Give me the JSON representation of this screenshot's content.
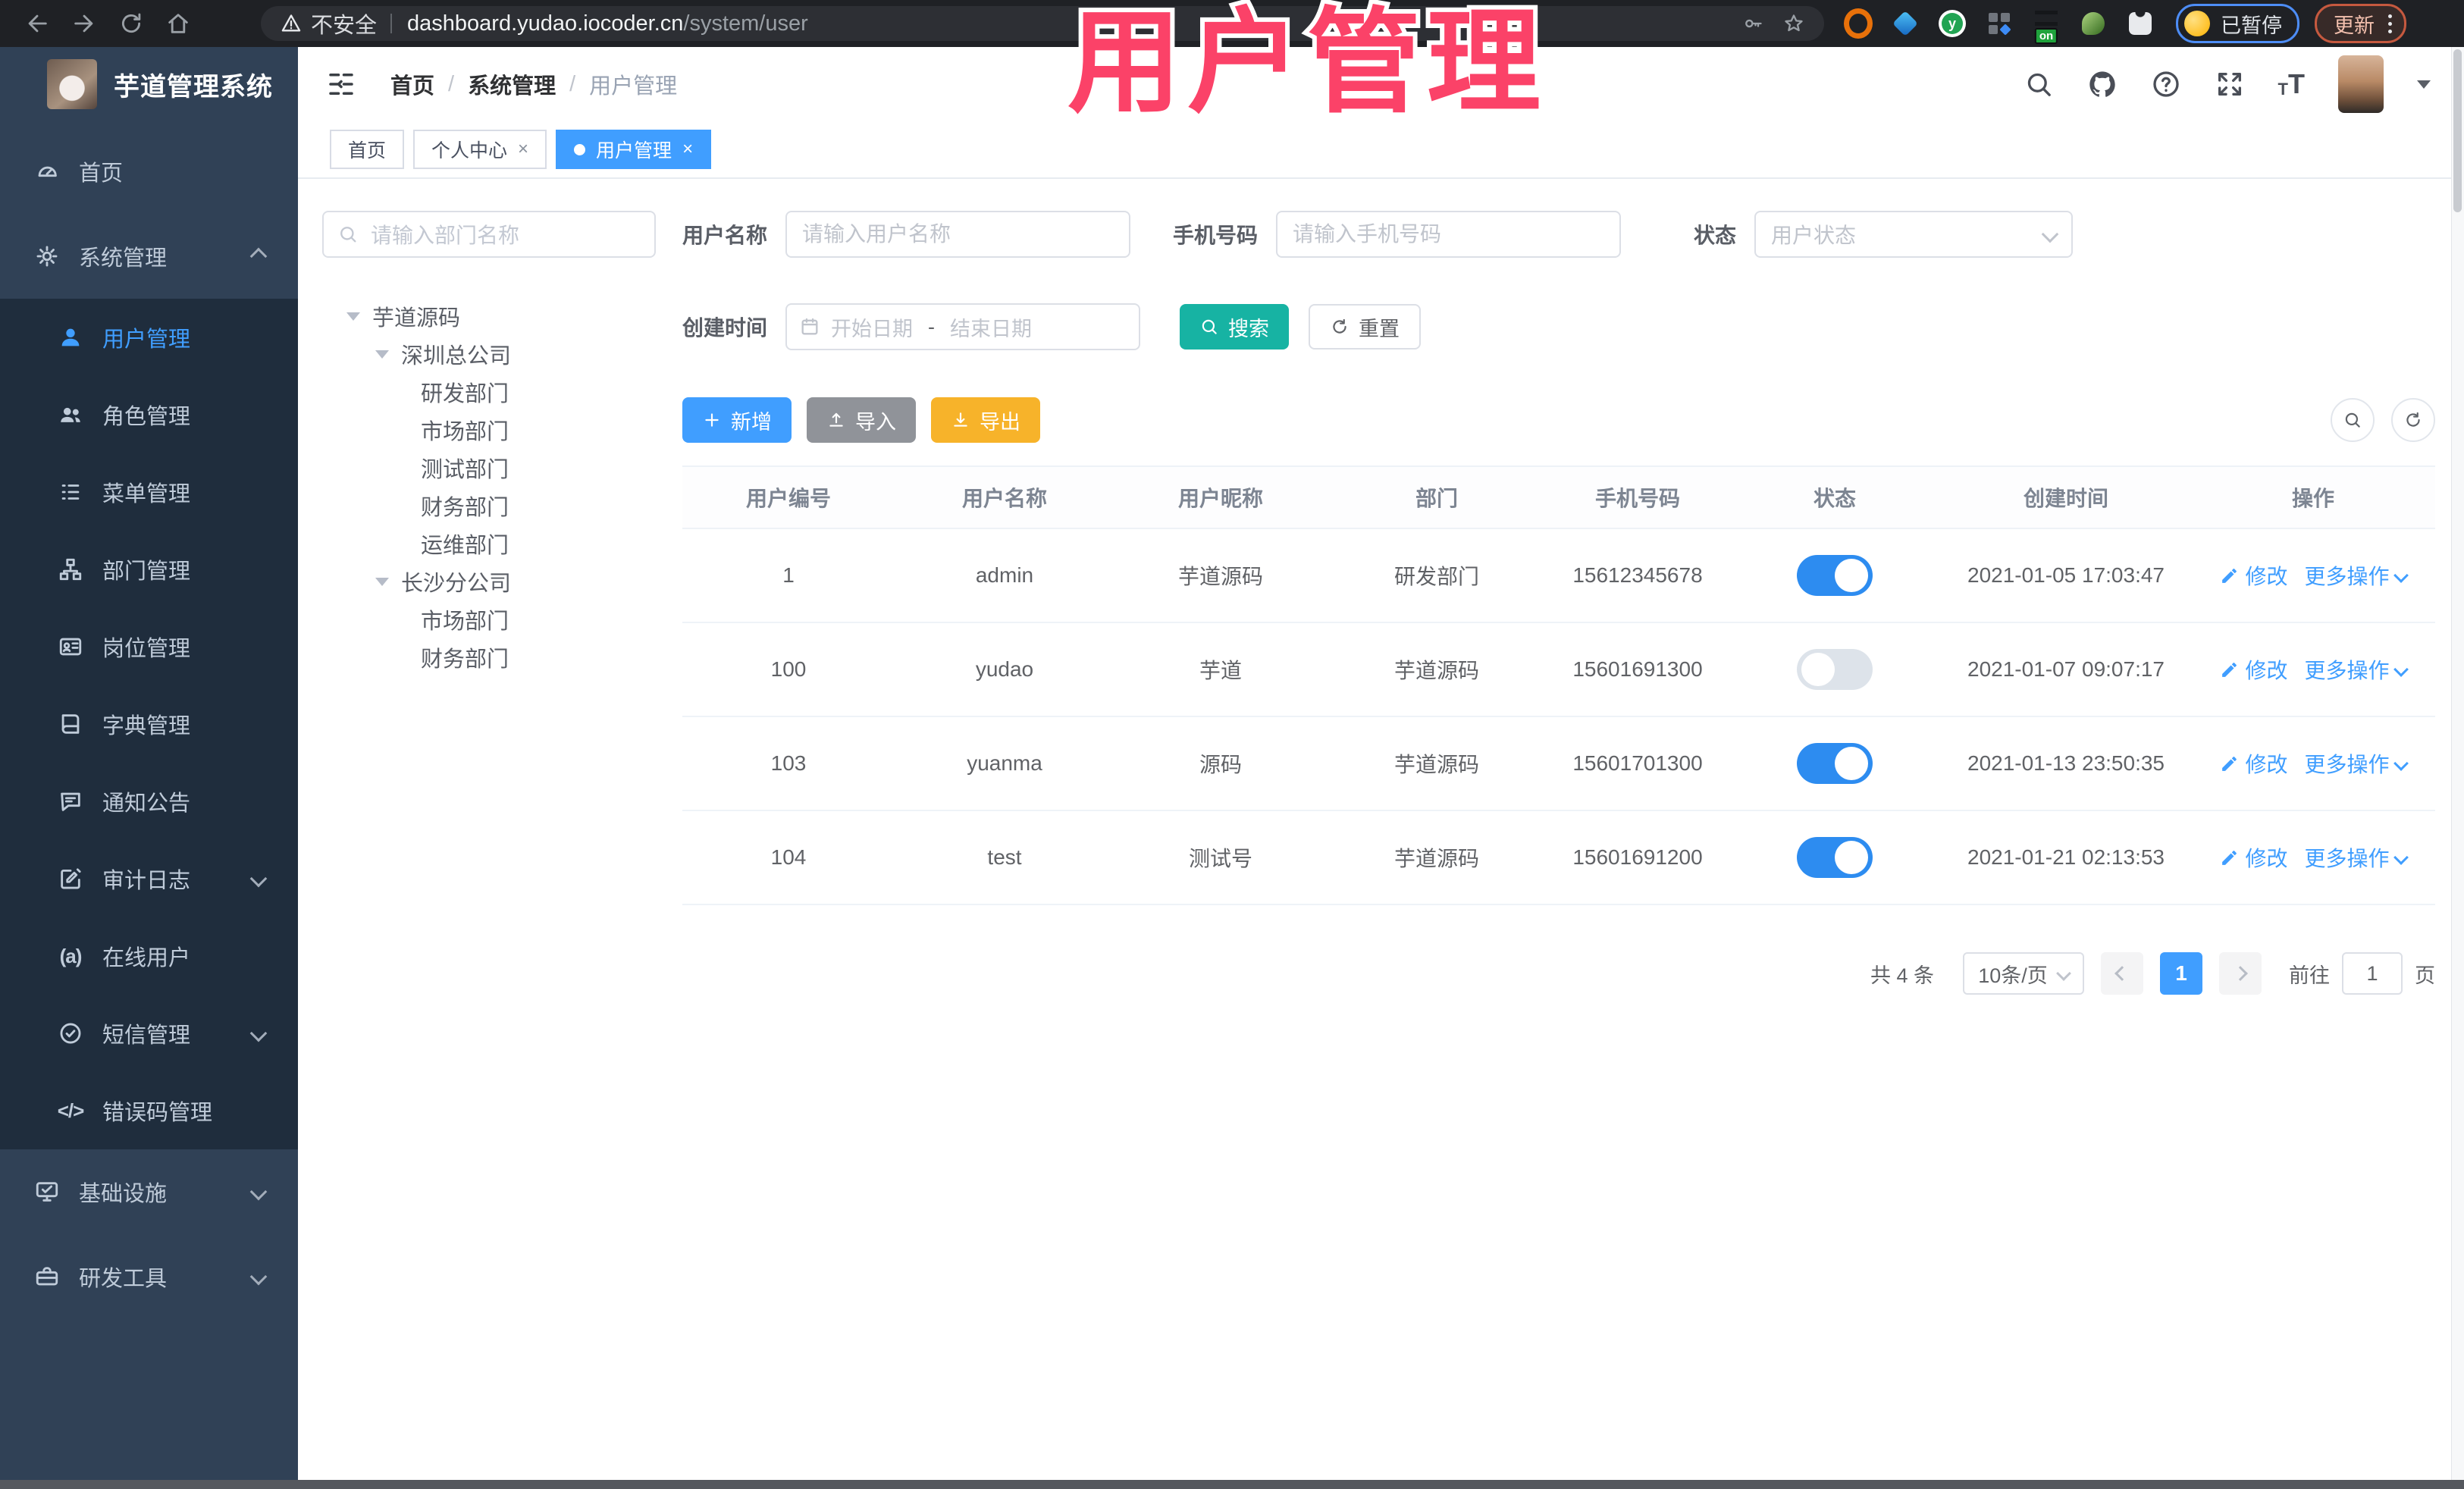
{
  "browser": {
    "security_label": "不安全",
    "url_host": "dashboard.yudao.iocoder.cn",
    "url_path": "/system/user",
    "extension_badge": "on",
    "paused_label": "已暂停",
    "update_label": "更新"
  },
  "overlay": {
    "title": "用户管理",
    "color": "#fb4268"
  },
  "app": {
    "logo_title": "芋道管理系统",
    "breadcrumb": [
      "首页",
      "系统管理",
      "用户管理"
    ],
    "tabs": [
      {
        "label": "首页",
        "closable": false,
        "active": false
      },
      {
        "label": "个人中心",
        "closable": true,
        "active": false
      },
      {
        "label": "用户管理",
        "closable": true,
        "active": true
      }
    ]
  },
  "sidebar": {
    "items": [
      {
        "key": "home",
        "label": "首页",
        "icon": "dashboard-icon",
        "type": "top"
      },
      {
        "key": "system",
        "label": "系统管理",
        "icon": "gear-icon",
        "type": "top",
        "chevron": "up"
      },
      {
        "key": "user",
        "label": "用户管理",
        "icon": "user-icon",
        "type": "sub",
        "active": true
      },
      {
        "key": "role",
        "label": "角色管理",
        "icon": "users-icon",
        "type": "sub"
      },
      {
        "key": "menu",
        "label": "菜单管理",
        "icon": "menu-tree-icon",
        "type": "sub"
      },
      {
        "key": "dept",
        "label": "部门管理",
        "icon": "org-tree-icon",
        "type": "sub"
      },
      {
        "key": "post",
        "label": "岗位管理",
        "icon": "id-card-icon",
        "type": "sub"
      },
      {
        "key": "dict",
        "label": "字典管理",
        "icon": "dictionary-icon",
        "type": "sub"
      },
      {
        "key": "notice",
        "label": "通知公告",
        "icon": "announcement-icon",
        "type": "sub"
      },
      {
        "key": "audit",
        "label": "审计日志",
        "icon": "audit-log-icon",
        "type": "sub",
        "chevron": "down"
      },
      {
        "key": "online",
        "label": "在线用户",
        "icon": "online-user-icon",
        "type": "sub"
      },
      {
        "key": "sms",
        "label": "短信管理",
        "icon": "sms-icon",
        "type": "sub",
        "chevron": "down"
      },
      {
        "key": "errcode",
        "label": "错误码管理",
        "icon": "error-code-icon",
        "type": "sub"
      },
      {
        "key": "infra",
        "label": "基础设施",
        "icon": "infrastructure-icon",
        "type": "top",
        "chevron": "down"
      },
      {
        "key": "devtool",
        "label": "研发工具",
        "icon": "dev-tools-icon",
        "type": "top",
        "chevron": "down"
      }
    ]
  },
  "dept_panel": {
    "search_placeholder": "请输入部门名称",
    "tree": [
      {
        "label": "芋道源码",
        "level": 0,
        "expandable": true
      },
      {
        "label": "深圳总公司",
        "level": 1,
        "expandable": true
      },
      {
        "label": "研发部门",
        "level": 2
      },
      {
        "label": "市场部门",
        "level": 2
      },
      {
        "label": "测试部门",
        "level": 2
      },
      {
        "label": "财务部门",
        "level": 2
      },
      {
        "label": "运维部门",
        "level": 2
      },
      {
        "label": "长沙分公司",
        "level": 1,
        "expandable": true
      },
      {
        "label": "市场部门",
        "level": 2
      },
      {
        "label": "财务部门",
        "level": 2
      }
    ]
  },
  "filters": {
    "username": {
      "label": "用户名称",
      "placeholder": "请输入用户名称"
    },
    "mobile": {
      "label": "手机号码",
      "placeholder": "请输入手机号码"
    },
    "status": {
      "label": "状态",
      "placeholder": "用户状态"
    },
    "create_time": {
      "label": "创建时间",
      "start_placeholder": "开始日期",
      "separator": "-",
      "end_placeholder": "结束日期"
    },
    "search_label": "搜索",
    "reset_label": "重置"
  },
  "toolbar": {
    "add_label": "新增",
    "import_label": "导入",
    "export_label": "导出"
  },
  "table": {
    "columns": [
      "用户编号",
      "用户名称",
      "用户昵称",
      "部门",
      "手机号码",
      "状态",
      "创建时间",
      "操作"
    ],
    "actions": {
      "edit": "修改",
      "more": "更多操作"
    },
    "rows": [
      {
        "id": "1",
        "username": "admin",
        "nickname": "芋道源码",
        "dept": "研发部门",
        "mobile": "15612345678",
        "status": true,
        "created": "2021-01-05 17:03:47"
      },
      {
        "id": "100",
        "username": "yudao",
        "nickname": "芋道",
        "dept": "芋道源码",
        "mobile": "15601691300",
        "status": false,
        "created": "2021-01-07 09:07:17"
      },
      {
        "id": "103",
        "username": "yuanma",
        "nickname": "源码",
        "dept": "芋道源码",
        "mobile": "15601701300",
        "status": true,
        "created": "2021-01-13 23:50:35"
      },
      {
        "id": "104",
        "username": "test",
        "nickname": "测试号",
        "dept": "芋道源码",
        "mobile": "15601691200",
        "status": true,
        "created": "2021-01-21 02:13:53"
      }
    ]
  },
  "pagination": {
    "total": "共 4 条",
    "page_size": "10条/页",
    "current_page": "1",
    "goto_label": "前往",
    "goto_value": "1",
    "unit_label": "页"
  },
  "colors": {
    "accent": "#409EFF",
    "search_button": "#17b3a3",
    "export_button": "#f7b32a",
    "toggle_on": "#2d8cf0",
    "sidebar_bg": "#304156",
    "submenu_bg": "#1f2d3d",
    "overlay_pink": "#fb4268"
  }
}
